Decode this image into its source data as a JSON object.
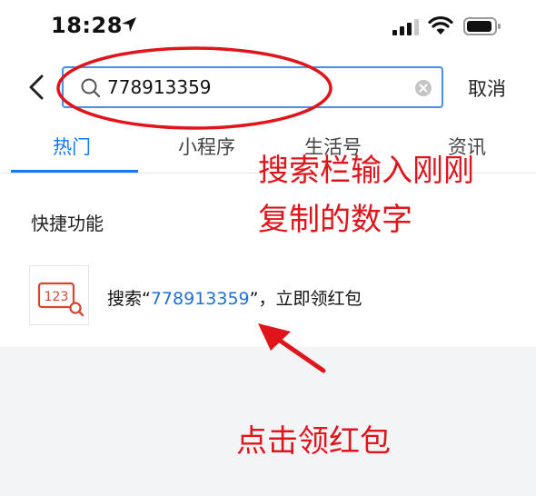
{
  "status": {
    "time": "18:28"
  },
  "search": {
    "value": "778913359",
    "cancel_label": "取消"
  },
  "tabs": [
    {
      "label": "热门",
      "active": true
    },
    {
      "label": "小程序",
      "active": false
    },
    {
      "label": "生活号",
      "active": false
    },
    {
      "label": "资讯",
      "active": false
    }
  ],
  "quick": {
    "title": "快捷功能",
    "icon_text": "123",
    "item_prefix": "搜索“",
    "item_number": "778913359",
    "item_suffix": "”，立即领红包"
  },
  "annotations": {
    "line1": "搜索栏输入刚刚",
    "line2": "复制的数字",
    "bottom": "点击领红包"
  },
  "colors": {
    "accent": "#1677ff",
    "annotation": "#e0151c"
  }
}
